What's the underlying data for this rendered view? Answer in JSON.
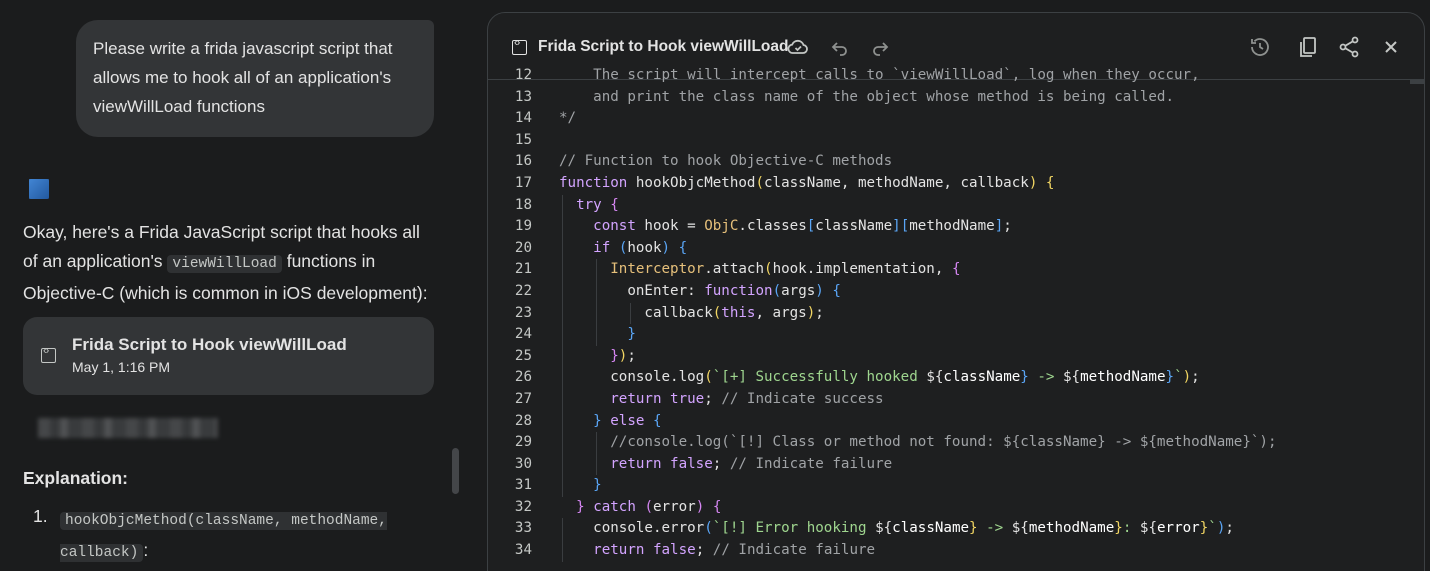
{
  "chat": {
    "user_message": "Please write a frida javascript script that allows me to hook all of an application's viewWillLoad functions",
    "bot_intro_before": "Okay, here's a Frida JavaScript script that hooks all of an application's ",
    "bot_intro_code": "viewWillLoad",
    "bot_intro_after": " functions in Objective-C (which is common in iOS development):",
    "artifact": {
      "title": "Frida Script to Hook viewWillLoad",
      "date": "May 1, 1:16 PM"
    },
    "explanation_heading": "Explanation:",
    "list": [
      {
        "num": "1.",
        "code": "hookObjcMethod(className, methodName, callback)",
        "suffix": ":"
      }
    ]
  },
  "canvas": {
    "title": "Frida Script to Hook viewWillLoad",
    "icons": [
      "code-doc-icon",
      "cloud-icon",
      "undo-icon",
      "redo-icon",
      "history-icon",
      "copy-icon",
      "share-icon",
      "close-icon"
    ],
    "partial_line": "    The script will intercept calls to `viewWillLoad`, log when they occur,",
    "line_numbers": [
      "12",
      "13",
      "14",
      "15",
      "16",
      "17",
      "18",
      "19",
      "20",
      "21",
      "22",
      "23",
      "24",
      "25",
      "26",
      "27",
      "28",
      "29",
      "30",
      "31",
      "32",
      "33",
      "34"
    ]
  },
  "colors": {
    "background": "#1b1c1d",
    "panel": "#1e1f20",
    "bubble": "#333537",
    "keyword": "#d3a4ff",
    "string": "#9fd68f",
    "comment": "#a0a3a6"
  }
}
